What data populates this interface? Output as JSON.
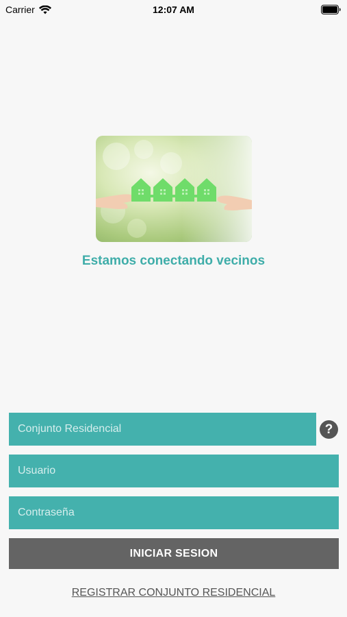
{
  "status_bar": {
    "carrier": "Carrier",
    "time": "12:07 AM"
  },
  "hero": {
    "tagline": "Estamos conectando vecinos"
  },
  "form": {
    "conjunto_placeholder": "Conjunto Residencial",
    "usuario_placeholder": "Usuario",
    "password_placeholder": "Contraseña",
    "help_label": "?",
    "login_label": "INICIAR SESION",
    "register_label": "REGISTRAR CONJUNTO RESIDENCIAL"
  },
  "colors": {
    "accent": "#44b1ad",
    "button": "#646464",
    "background": "#f7f7f7"
  }
}
